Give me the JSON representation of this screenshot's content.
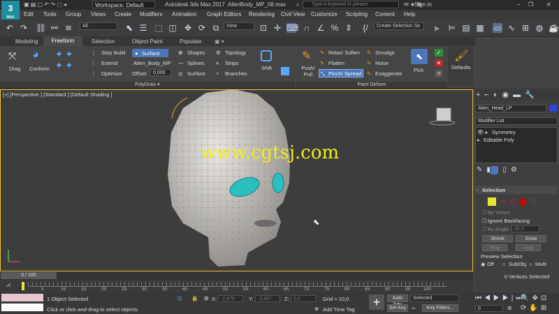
{
  "titlebar": {
    "workspace": "Workspace: Default",
    "app": "Autodesk 3ds Max 2017",
    "file": "AlienBody_MP_08.max",
    "search_placeholder": "Type a keyword or phrase",
    "sign_in": "Sign In",
    "logo": "3",
    "logo_sub": "MAX"
  },
  "menu": [
    "Edit",
    "Tools",
    "Group",
    "Views",
    "Create",
    "Modifiers",
    "Animation",
    "Graph Editors",
    "Rendering",
    "Civil View",
    "Customize",
    "Scripting",
    "Content",
    "Help"
  ],
  "toolbar": {
    "filter": "All",
    "view": "View",
    "selection_set": "Create Selection Se"
  },
  "ribbon": {
    "tabs": [
      "Modeling",
      "Freeform",
      "Selection",
      "Object Paint",
      "Populate"
    ],
    "drag": "Drag",
    "conform": "Conform",
    "step_build": "Step Build",
    "extend": "Extend",
    "optimize": "Optimize",
    "surface": "Surface",
    "surface_object": "Alien_Body_MP",
    "offset_label": "Offset:",
    "offset_value": "0,000",
    "shapes": "Shapes",
    "splines": "Splines",
    "surface2": "Surface",
    "topology": "Topology",
    "strips": "Strips",
    "branches": "Branches",
    "shift": "Shift",
    "push_pull": "Push/ Pull",
    "relax_soften": "Relax/ Soften",
    "flatten": "Flatten",
    "pinch_spread": "Pinch/ Spread",
    "smudge": "Smudge",
    "noise": "Noise",
    "exaggerate": "Exaggerate",
    "pick": "Pick",
    "defaults": "Defaults",
    "polydraw_label": "PolyDraw",
    "paint_deform_label": "Paint Deform"
  },
  "viewport": {
    "label": "[+] [Perspective ] [Standard ] [Default Shading ]",
    "watermark": "www.cgtsj.com"
  },
  "cmdpanel": {
    "object_name": "Alien_Head_LP",
    "modifier_list": "Modifier List",
    "stack": [
      "Symmetry",
      "Editable Poly"
    ],
    "selection_header": "Selection",
    "by_vertex": "By Vertex",
    "ignore_backfacing": "Ignore Backfacing",
    "by_angle": "By Angle:",
    "angle_value": "45,0",
    "shrink": "Shrink",
    "grow": "Grow",
    "ring": "Ring",
    "loop": "Loop",
    "preview_selection": "Preview Selection",
    "preview_options": [
      "Off",
      "SubObj",
      "Multi"
    ],
    "status": "0 Vertices Selected",
    "object_color": "#3344dd"
  },
  "timeline": {
    "frame": "0 / 100",
    "ticks": [
      "0",
      "5",
      "10",
      "15",
      "20",
      "25",
      "30",
      "35",
      "40",
      "45",
      "50",
      "55",
      "60",
      "65",
      "70",
      "75",
      "80",
      "85",
      "90",
      "95",
      "100"
    ]
  },
  "status": {
    "selected": "1 Object Selected",
    "hint": "Click or click-and-drag to select objects",
    "x_label": "X:",
    "x_value": "-2,478",
    "y_label": "Y:",
    "y_value": "-3,467",
    "z_label": "Z:",
    "z_value": "0,0",
    "grid": "Grid = 10,0",
    "add_time_tag": "Add Time Tag",
    "auto_key": "Auto Key",
    "set_key": "Set Key",
    "selected_dd": "Selected",
    "key_filters": "Key Filters...",
    "frame_value": "0"
  }
}
